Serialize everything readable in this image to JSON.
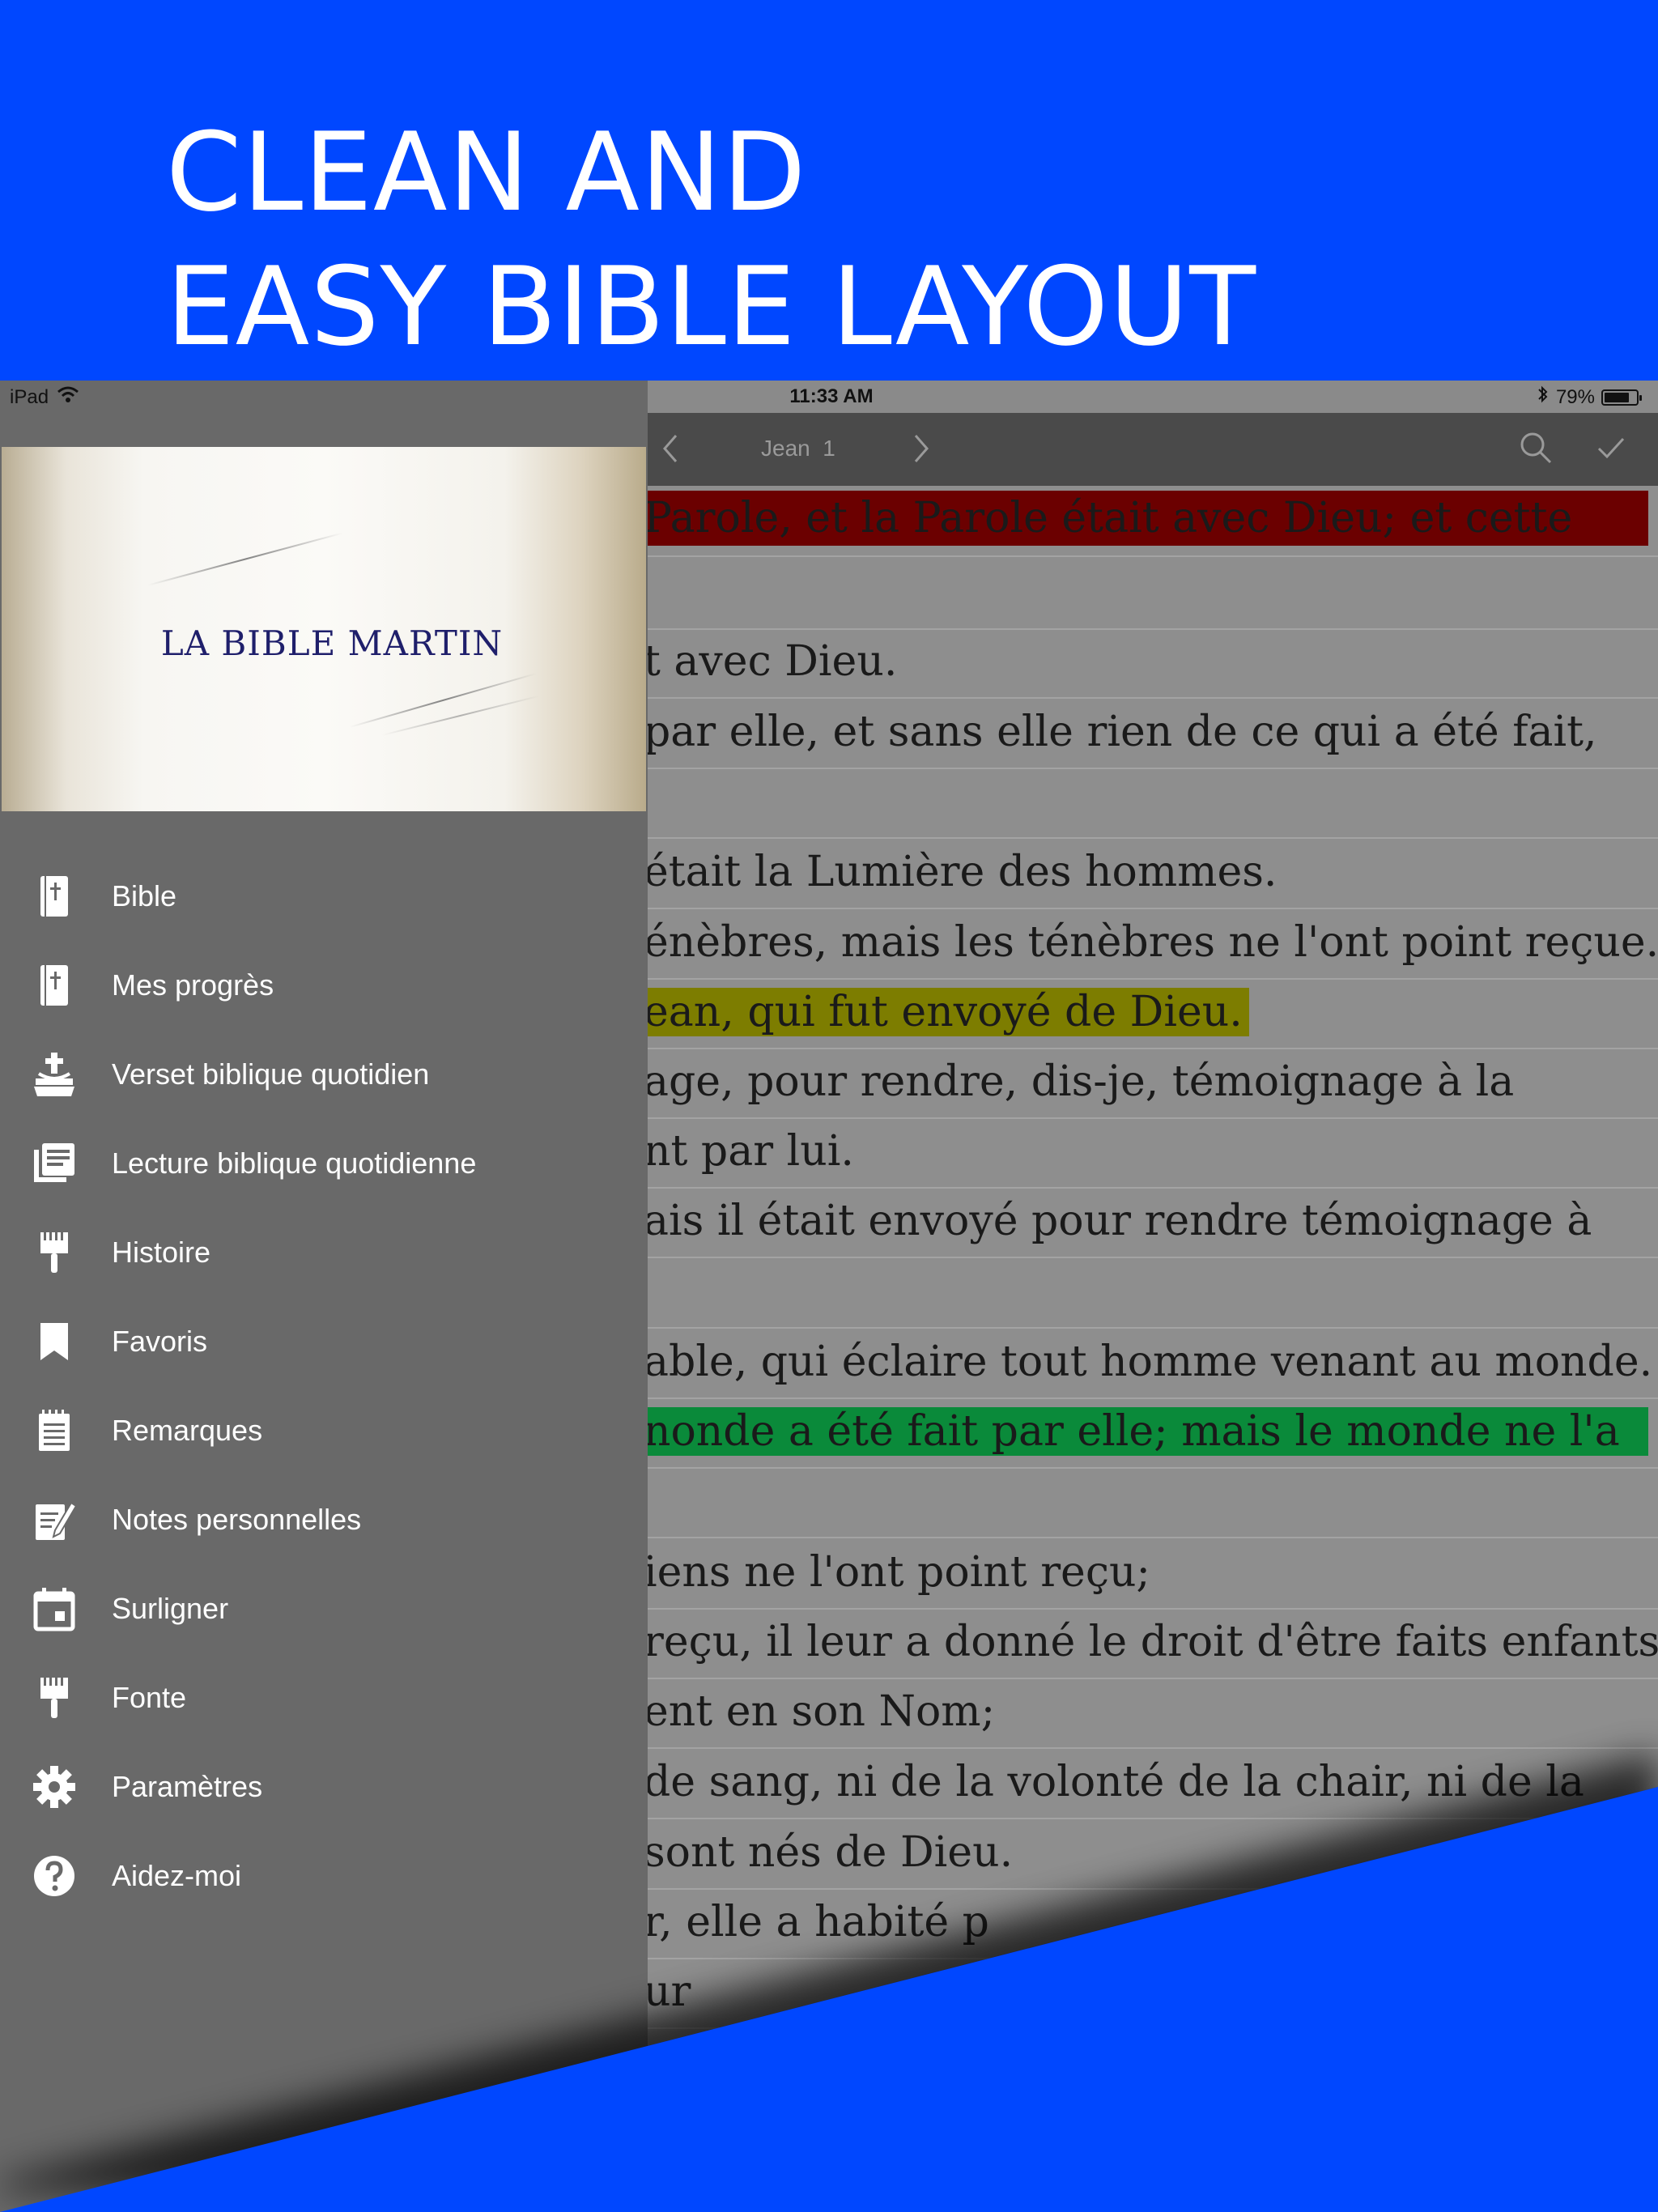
{
  "headline": {
    "line1": "CLEAN AND",
    "line2": "EASY BIBLE LAYOUT"
  },
  "status_bar": {
    "device": "iPad",
    "time": "11:33 AM",
    "battery": "79%",
    "battery_level": 0.79
  },
  "reader_nav": {
    "title": "Jean",
    "chapter": "1"
  },
  "drawer": {
    "banner_text": "LA  BIBLE MARTIN",
    "items": [
      {
        "label": "Bible",
        "icon": "bible-icon"
      },
      {
        "label": "Mes progrès",
        "icon": "bible-progress-icon"
      },
      {
        "label": "Verset biblique quotidien",
        "icon": "daily-verse-icon"
      },
      {
        "label": "Lecture biblique quotidienne",
        "icon": "library-icon"
      },
      {
        "label": "Histoire",
        "icon": "brush-icon"
      },
      {
        "label": "Favoris",
        "icon": "bookmark-icon"
      },
      {
        "label": "Remarques",
        "icon": "notepad-icon"
      },
      {
        "label": "Notes personnelles",
        "icon": "edit-note-icon"
      },
      {
        "label": "Surligner",
        "icon": "calendar-icon"
      },
      {
        "label": "Fonte",
        "icon": "brush-icon"
      },
      {
        "label": "Paramètres",
        "icon": "gear-icon"
      },
      {
        "label": "Aidez-moi",
        "icon": "help-icon"
      }
    ]
  },
  "verses": [
    {
      "text": "Parole, et la Parole était avec Dieu; et cette",
      "highlight": "red"
    },
    {
      "text": "",
      "highlight": ""
    },
    {
      "text": "t avec Dieu.",
      "highlight": ""
    },
    {
      "text": " par elle, et sans elle rien de ce qui a été fait,",
      "highlight": ""
    },
    {
      "text": "",
      "highlight": ""
    },
    {
      "text": "était la Lumière des hommes.",
      "highlight": ""
    },
    {
      "text": "énèbres, mais les ténèbres ne l'ont point reçue.",
      "highlight": ""
    },
    {
      "text": "ean, qui fut envoyé de Dieu.",
      "highlight": "yellow"
    },
    {
      "text": "age, pour rendre, dis-je, témoignage à la",
      "highlight": ""
    },
    {
      "text": "nt par lui.",
      "highlight": ""
    },
    {
      "text": "ais il était envoyé pour rendre témoignage à",
      "highlight": ""
    },
    {
      "text": "",
      "highlight": ""
    },
    {
      "text": "able, qui éclaire tout homme venant au monde.",
      "highlight": ""
    },
    {
      "text": "nonde a été fait par elle; mais le monde ne l'a",
      "highlight": "green"
    },
    {
      "text": "",
      "highlight": ""
    },
    {
      "text": "iens ne l'ont point reçu;",
      "highlight": ""
    },
    {
      "text": "reçu, il leur a donné le droit d'être faits enfants",
      "highlight": ""
    },
    {
      "text": "ent en son Nom;",
      "highlight": ""
    },
    {
      "text": " de sang, ni de la volonté de la chair, ni de la",
      "highlight": ""
    },
    {
      "text": "sont nés de Dieu.",
      "highlight": ""
    },
    {
      "text": "r, elle a habité p",
      "highlight": ""
    },
    {
      "text": "ur",
      "highlight": ""
    }
  ],
  "colors": {
    "background": "#0047FF",
    "highlight_red": "#6b0000",
    "highlight_yellow": "#7d7d00",
    "highlight_green": "#0a8a3a"
  }
}
